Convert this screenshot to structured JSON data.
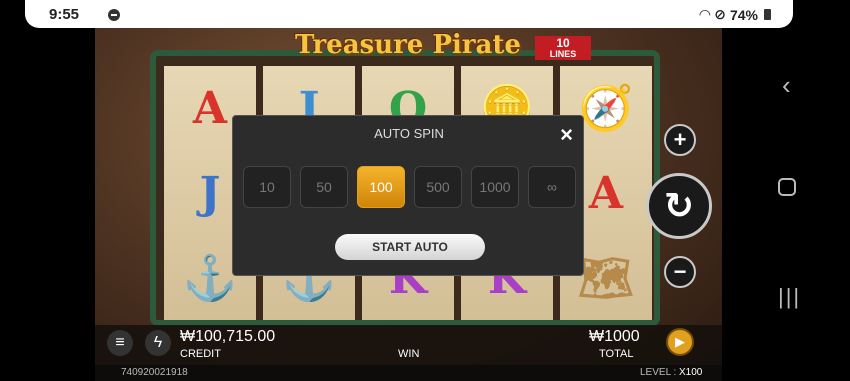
{
  "status_bar": {
    "time": "9:55",
    "battery": "74%"
  },
  "game": {
    "title": "Treasure Pirate",
    "lines_count": "10",
    "lines_label": "LINES"
  },
  "reels": [
    [
      {
        "label": "A",
        "color": "#d9342b"
      },
      {
        "label": "J",
        "color": "#3d73c9"
      },
      {
        "label": "⚓",
        "color": "#7a2414"
      }
    ],
    [
      {
        "label": "J",
        "color": "#3d8fd1"
      },
      {
        "label": "",
        "color": "#000000"
      },
      {
        "label": "⚓",
        "color": "#8aa0b0"
      }
    ],
    [
      {
        "label": "Q",
        "color": "#33a34a"
      },
      {
        "label": "",
        "color": "#000000"
      },
      {
        "label": "K",
        "color": "#a83fc4"
      }
    ],
    [
      {
        "label": "🪙",
        "color": "#d9a21b"
      },
      {
        "label": "",
        "color": "#000000"
      },
      {
        "label": "K",
        "color": "#a83fc4"
      }
    ],
    [
      {
        "label": "🧭",
        "color": "#2c6fb5"
      },
      {
        "label": "A",
        "color": "#d9342b"
      },
      {
        "label": "🗺",
        "color": "#b58a4a"
      }
    ]
  ],
  "modal": {
    "title": "AUTO SPIN",
    "close_icon": "×",
    "options": [
      "10",
      "50",
      "100",
      "500",
      "1000",
      "∞"
    ],
    "selected": "100",
    "start_label": "START AUTO"
  },
  "bottom": {
    "credit_value": "₩100,715.00",
    "credit_label": "CREDIT",
    "win_label": "WIN",
    "total_value": "₩1000",
    "total_label": "TOTAL",
    "game_id": "740920021918",
    "level_label": "LEVEL :",
    "level_value": "X100"
  },
  "colors": {
    "accent": "#e0a020",
    "frame": "#2d5a3a"
  }
}
